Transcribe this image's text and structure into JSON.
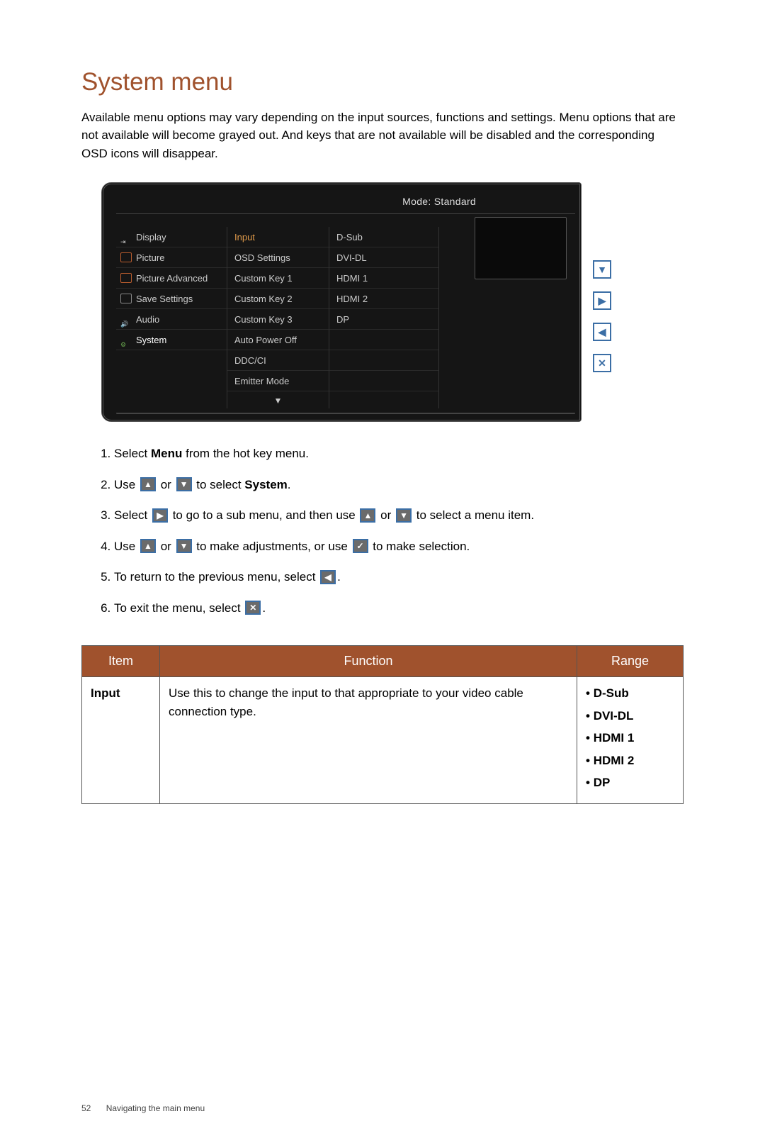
{
  "title": "System menu",
  "intro": "Available menu options may vary depending on the input sources, functions and settings. Menu options that are not available will become grayed out. And keys that are not available will be disabled and the corresponding OSD icons will disappear.",
  "osd": {
    "mode_label": "Mode: Standard",
    "col1": [
      {
        "label": "Display"
      },
      {
        "label": "Picture"
      },
      {
        "label": "Picture Advanced"
      },
      {
        "label": "Save Settings"
      },
      {
        "label": "Audio"
      },
      {
        "label": "System",
        "active": true
      }
    ],
    "col2": [
      {
        "label": "Input",
        "highlight": true
      },
      {
        "label": "OSD Settings"
      },
      {
        "label": "Custom Key 1"
      },
      {
        "label": "Custom Key 2"
      },
      {
        "label": "Custom Key 3"
      },
      {
        "label": "Auto Power Off"
      },
      {
        "label": "DDC/CI"
      },
      {
        "label": "Emitter Mode"
      }
    ],
    "col3": [
      {
        "label": "D-Sub"
      },
      {
        "label": "DVI-DL"
      },
      {
        "label": "HDMI 1"
      },
      {
        "label": "HDMI 2"
      },
      {
        "label": "DP"
      }
    ],
    "scroll_indicator": "▼"
  },
  "side_buttons": [
    "▼",
    "▶",
    "◀",
    "✕"
  ],
  "steps": {
    "s1a": "Select ",
    "s1b": "Menu",
    "s1c": " from the hot key menu.",
    "s2a": "Use ",
    "s2b": " or ",
    "s2c": " to select ",
    "s2d": "System",
    "s2e": ".",
    "s3a": "Select ",
    "s3b": " to go to a sub menu, and then use ",
    "s3c": " or ",
    "s3d": " to select a menu item.",
    "s4a": "Use ",
    "s4b": " or ",
    "s4c": " to make adjustments, or use ",
    "s4d": " to make selection.",
    "s5a": "To return to the previous menu, select ",
    "s5b": ".",
    "s6a": "To exit the menu, select ",
    "s6b": "."
  },
  "icons": {
    "up": "▲",
    "down": "▼",
    "right": "▶",
    "left": "◀",
    "check": "✓",
    "close": "✕"
  },
  "table": {
    "headers": [
      "Item",
      "Function",
      "Range"
    ],
    "row": {
      "item": "Input",
      "function": "Use this to change the input to that appropriate to your video cable connection type.",
      "range": [
        "D-Sub",
        "DVI-DL",
        "HDMI 1",
        "HDMI 2",
        "DP"
      ]
    }
  },
  "footer": {
    "page": "52",
    "section": "Navigating the main menu"
  }
}
